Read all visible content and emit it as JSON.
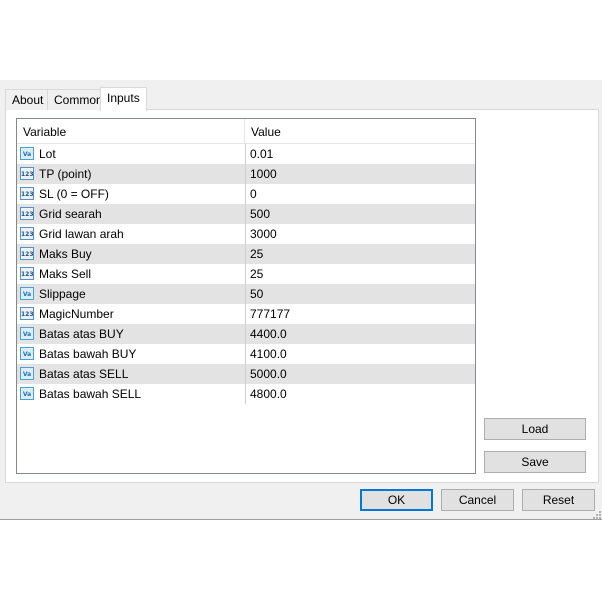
{
  "tabs": [
    {
      "label": "About",
      "active": false
    },
    {
      "label": "Common",
      "active": false
    },
    {
      "label": "Inputs",
      "active": true
    }
  ],
  "grid": {
    "columns": [
      "Variable",
      "Value"
    ],
    "rows": [
      {
        "icon": "text-value-icon",
        "name": "Lot",
        "value": "0.01"
      },
      {
        "icon": "integer-value-icon",
        "name": "TP (point)",
        "value": "1000"
      },
      {
        "icon": "integer-value-icon",
        "name": "SL (0 = OFF)",
        "value": "0"
      },
      {
        "icon": "integer-value-icon",
        "name": "Grid searah",
        "value": "500"
      },
      {
        "icon": "integer-value-icon",
        "name": "Grid lawan arah",
        "value": "3000"
      },
      {
        "icon": "integer-value-icon",
        "name": "Maks Buy",
        "value": "25"
      },
      {
        "icon": "integer-value-icon",
        "name": "Maks Sell",
        "value": "25"
      },
      {
        "icon": "text-value-icon",
        "name": "Slippage",
        "value": "50"
      },
      {
        "icon": "integer-value-icon",
        "name": "MagicNumber",
        "value": "777177"
      },
      {
        "icon": "text-value-icon",
        "name": "Batas atas BUY",
        "value": "4400.0"
      },
      {
        "icon": "text-value-icon",
        "name": "Batas bawah BUY",
        "value": "4100.0"
      },
      {
        "icon": "text-value-icon",
        "name": "Batas atas SELL",
        "value": "5000.0"
      },
      {
        "icon": "text-value-icon",
        "name": "Batas bawah SELL",
        "value": "4800.0"
      }
    ]
  },
  "side_buttons": {
    "load": "Load",
    "save": "Save"
  },
  "footer_buttons": {
    "ok": "OK",
    "cancel": "Cancel",
    "reset": "Reset"
  },
  "icon_text": {
    "text": "Va",
    "integer": "123"
  }
}
